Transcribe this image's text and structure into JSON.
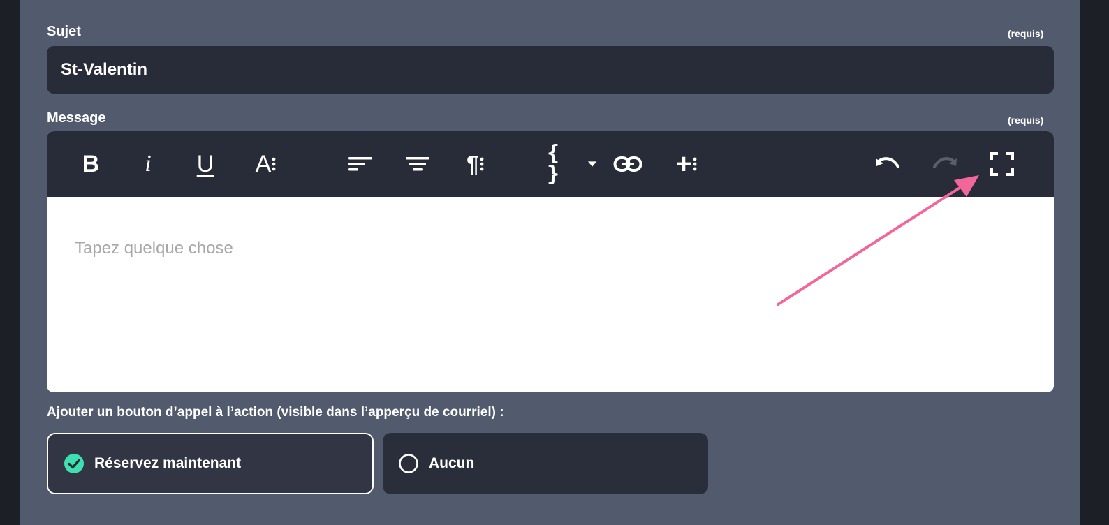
{
  "subject": {
    "label": "Sujet",
    "required": "(requis)",
    "value": "St-Valentin"
  },
  "message": {
    "label": "Message",
    "required": "(requis)",
    "placeholder": "Tapez quelque chose",
    "toolbar": {
      "bold": "B",
      "italic": "i",
      "underline": "U",
      "font_size": "A",
      "braces": "{ }",
      "insert": "+"
    }
  },
  "cta": {
    "label": "Ajouter un bouton d’appel à l’action (visible dans l’apperçu de courriel) :",
    "options": [
      {
        "label": "Réservez maintenant",
        "selected": true
      },
      {
        "label": "Aucun",
        "selected": false
      }
    ]
  },
  "colors": {
    "panel": "#525a6e",
    "dark": "#282c38",
    "check": "#3fe0b0",
    "annotation_arrow": "#f2679a"
  }
}
